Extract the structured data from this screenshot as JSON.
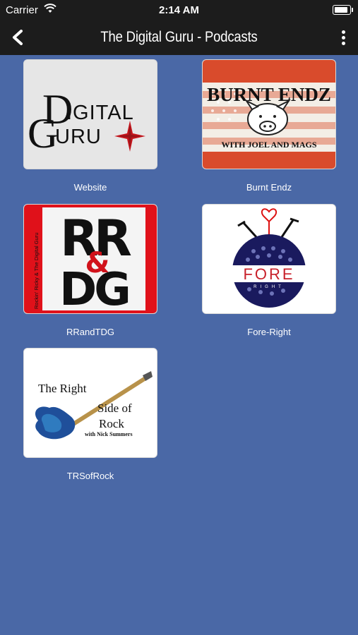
{
  "status_bar": {
    "carrier": "Carrier",
    "time": "2:14 AM",
    "icons": [
      "wifi-icon",
      "battery-icon"
    ]
  },
  "nav": {
    "title": "The Digital Guru - Podcasts",
    "back_icon": "chevron-left-icon",
    "menu_icon": "more-vertical-icon"
  },
  "podcasts": [
    {
      "label": "Website",
      "art": {
        "line1": "Digital",
        "line2": "Guru"
      }
    },
    {
      "label": "Burnt Endz",
      "art": {
        "title": "BURNT ENDZ",
        "subtitle": "WITH JOEL AND MAGS"
      }
    },
    {
      "label": "RRandTDG",
      "art": {
        "top": "RR",
        "amp": "&",
        "bottom": "DG",
        "side": "Rockin' Ricky & The Digital Guru"
      }
    },
    {
      "label": "Fore-Right",
      "art": {
        "word": "FORE",
        "sub": "RIGHT"
      }
    },
    {
      "label": "TRSofRock",
      "art": {
        "line1": "The Right",
        "line2": "Side of",
        "line3": "Rock",
        "line4": "with Nick Summers"
      }
    }
  ],
  "colors": {
    "background": "#4a68a6",
    "bars": "#1c1c1c",
    "rr_red": "#e0111a",
    "burnt_red": "#d94b2c"
  }
}
